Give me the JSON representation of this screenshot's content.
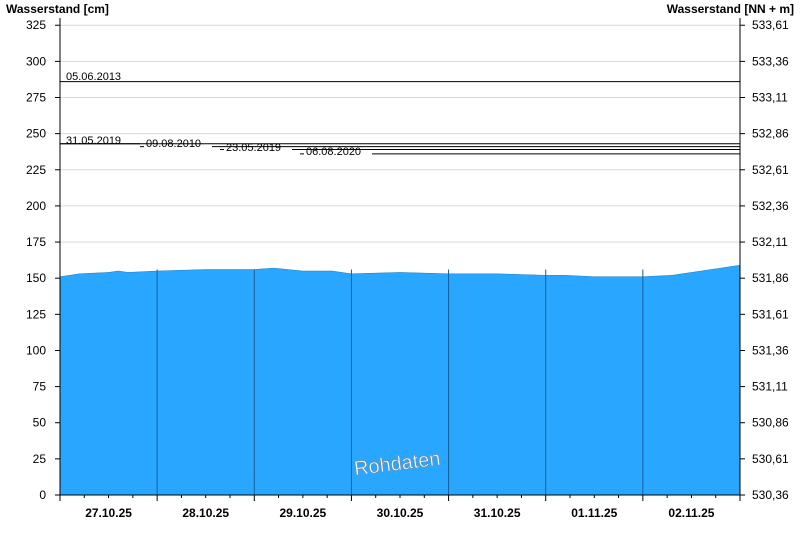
{
  "chart_data": {
    "type": "area",
    "ylabel_left": "Wasserstand [cm]",
    "ylabel_right": "Wasserstand [NN + m]",
    "ylim": [
      0,
      330
    ],
    "yticks_left": [
      0,
      25,
      50,
      75,
      100,
      125,
      150,
      175,
      200,
      225,
      250,
      275,
      300,
      325
    ],
    "yticks_right": [
      "530,36",
      "530,61",
      "530,86",
      "531,11",
      "531,36",
      "531,61",
      "531,86",
      "532,11",
      "532,36",
      "532,61",
      "532,86",
      "533,11",
      "533,36",
      "533,61"
    ],
    "x_days": [
      "27.10.25",
      "28.10.25",
      "29.10.25",
      "30.10.25",
      "31.10.25",
      "01.11.25",
      "02.11.25"
    ],
    "x_range_days": [
      0,
      7
    ],
    "grid": true,
    "series": [
      {
        "x": [
          0,
          0.1,
          0.2,
          0.5,
          0.6,
          0.7,
          1.0,
          1.5,
          2.0,
          2.2,
          2.5,
          2.8,
          3.0,
          3.5,
          4.0,
          4.5,
          5.0,
          5.2,
          5.5,
          6.0,
          6.3,
          6.6,
          6.8,
          7.0
        ],
        "y": [
          151,
          152,
          153,
          154,
          155,
          154,
          155,
          156,
          156,
          157,
          155,
          155,
          153,
          154,
          153,
          153,
          152,
          152,
          151,
          151,
          152,
          155,
          157,
          159
        ],
        "color": "#29a6ff"
      }
    ],
    "reference_lines": [
      {
        "label": "05.06.2013",
        "value": 286
      },
      {
        "label": "31.05.2019",
        "value": 243
      },
      {
        "label": "09.08.2010",
        "value": 241
      },
      {
        "label": "23.05.2019",
        "value": 239
      },
      {
        "label": "06.08.2020",
        "value": 236
      }
    ],
    "annotation": "Rohdaten"
  }
}
